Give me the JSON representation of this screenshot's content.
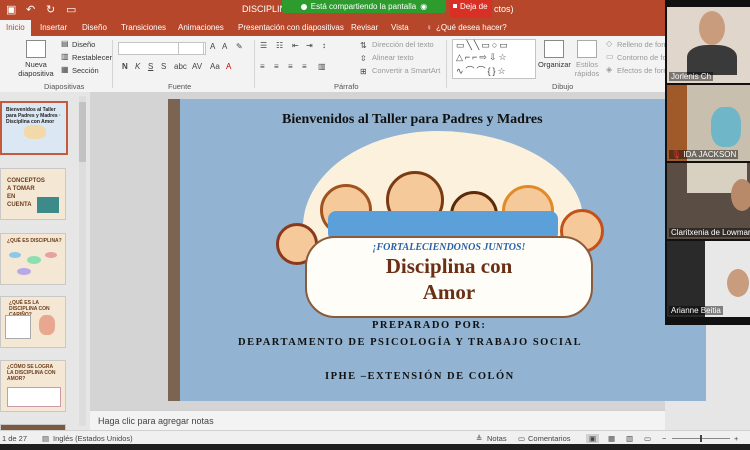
{
  "title_bar": {
    "doc_title": "DISCIPLINA",
    "title_tail": "ctos)",
    "share_status": "Está compartiendo la pantalla",
    "stop_share": "Deja de"
  },
  "tabs": [
    "Inicio",
    "Insertar",
    "Diseño",
    "Transiciones",
    "Animaciones",
    "Presentación con diapositivas",
    "Revisar",
    "Vista"
  ],
  "tell_me": "¿Qué desea hacer?",
  "ribbon": {
    "new_slide": "Nueva diapositiva",
    "layout": "Diseño",
    "reset": "Restablecer",
    "section": "Sección",
    "group_slides": "Diapositivas",
    "group_font": "Fuente",
    "group_paragraph": "Párrafo",
    "group_drawing": "Dibujo",
    "text_direction": "Dirección del texto",
    "align_text": "Alinear texto",
    "smartart": "Convertir a SmartArt",
    "organize": "Organizar",
    "quick_styles": "Estilos rápidos",
    "shape_fill": "Relleno de forma",
    "shape_outline": "Contorno de forma",
    "shape_effects": "Efectos de forma",
    "font_buttons": [
      "N",
      "K",
      "S",
      "S"
    ]
  },
  "thumbs": [
    {
      "num": "",
      "lines": "Bienvenidos al Taller para Padres y Madres · Disciplina con Amor"
    },
    {
      "num": "",
      "lines": "CONCEPTOS A TOMAR EN CUENTA"
    },
    {
      "num": "",
      "lines": "¿QUÉ ES DISCIPLINA?"
    },
    {
      "num": "",
      "lines": "¿QUÉ ES LA DISCIPLINA CON CARIÑO?"
    },
    {
      "num": "",
      "lines": "¿CÓMO SE LOGRA LA DISCIPLINA CON AMOR?"
    },
    {
      "num": "",
      "lines": ""
    }
  ],
  "slide": {
    "title": "Bienvenidos al  Taller para Padres y Madres",
    "banner_sub": "¡FORTALECIENDONOS JUNTOS!",
    "banner_main_line1": "Disciplina con",
    "banner_main_line2": "Amor",
    "prepared_by": "PREPARADO POR:",
    "department": "DEPARTAMENTO DE PSICOLOGÍA Y TRABAJO SOCIAL",
    "institution": "IPHE –EXTENSIÓN DE COLÓN"
  },
  "notes_placeholder": "Haga clic para agregar notas",
  "status": {
    "slide_count": "1 de 27",
    "language": "Inglés (Estados Unidos)",
    "notes": "Notas",
    "comments": "Comentarios"
  },
  "participants": [
    {
      "name": "Jorlenis Ch"
    },
    {
      "name": "IDA JACKSON"
    },
    {
      "name": "Claritxenia de Lowman"
    },
    {
      "name": "Arianne Beitia"
    }
  ]
}
